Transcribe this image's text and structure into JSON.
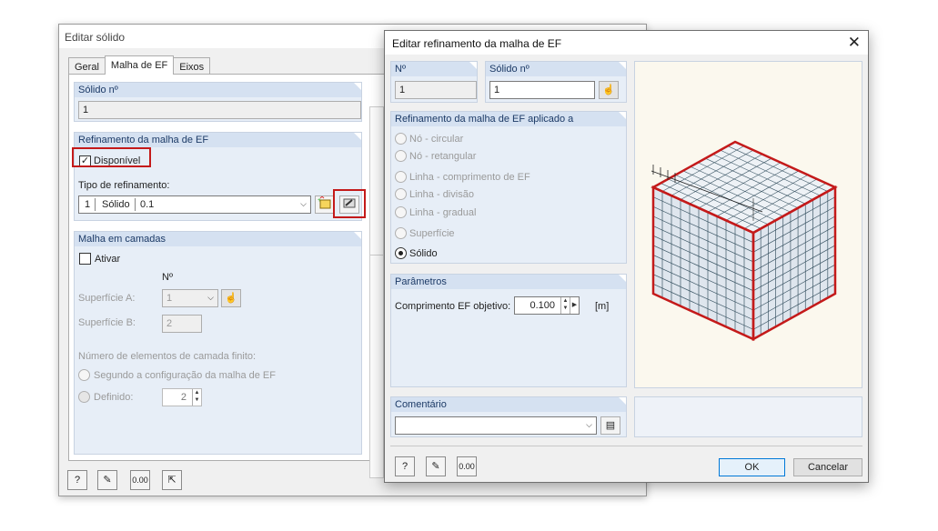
{
  "win1": {
    "title": "Editar sólido",
    "tabs": [
      "Geral",
      "Malha de EF",
      "Eixos"
    ],
    "solid_no_label": "Sólido nº",
    "solid_no_value": "1",
    "refinement_header": "Refinamento da malha de EF",
    "available_label": "Disponível",
    "refinement_type_label": "Tipo de refinamento:",
    "refinement_type": {
      "no": "1",
      "kind": "Sólido",
      "value": "0.1"
    },
    "layers_header": "Malha em camadas",
    "activate_label": "Ativar",
    "no_header": "Nº",
    "surface_a_label": "Superfície A:",
    "surface_a_value": "1",
    "surface_b_label": "Superfície B:",
    "surface_b_value": "2",
    "layer_count_label": "Número de elementos de camada finito:",
    "option_config": "Segundo a configuração da malha de EF",
    "option_defined": "Definido:",
    "defined_value": "2"
  },
  "win2": {
    "title": "Editar refinamento da malha de EF",
    "no_label": "Nº",
    "no_value": "1",
    "solid_no_label": "Sólido nº",
    "solid_no_value": "1",
    "applied_header": "Refinamento da malha de EF aplicado a",
    "options": [
      "Nó - circular",
      "Nó - retangular",
      "Linha - comprimento de EF",
      "Linha - divisão",
      "Linha - gradual",
      "Superfície",
      "Sólido"
    ],
    "selected_option": "Sólido",
    "params_header": "Parâmetros",
    "target_length_label": "Comprimento EF objetivo:",
    "target_length_value": "0.100",
    "target_length_unit": "[m]",
    "comment_header": "Comentário",
    "comment_value": "",
    "ok_label": "OK",
    "cancel_label": "Cancelar"
  },
  "colors": {
    "highlight": "#c41a1a",
    "group_header": "#d5e1f1",
    "group_bg": "#e7eef7",
    "preview_bg": "#fbf8ee"
  }
}
